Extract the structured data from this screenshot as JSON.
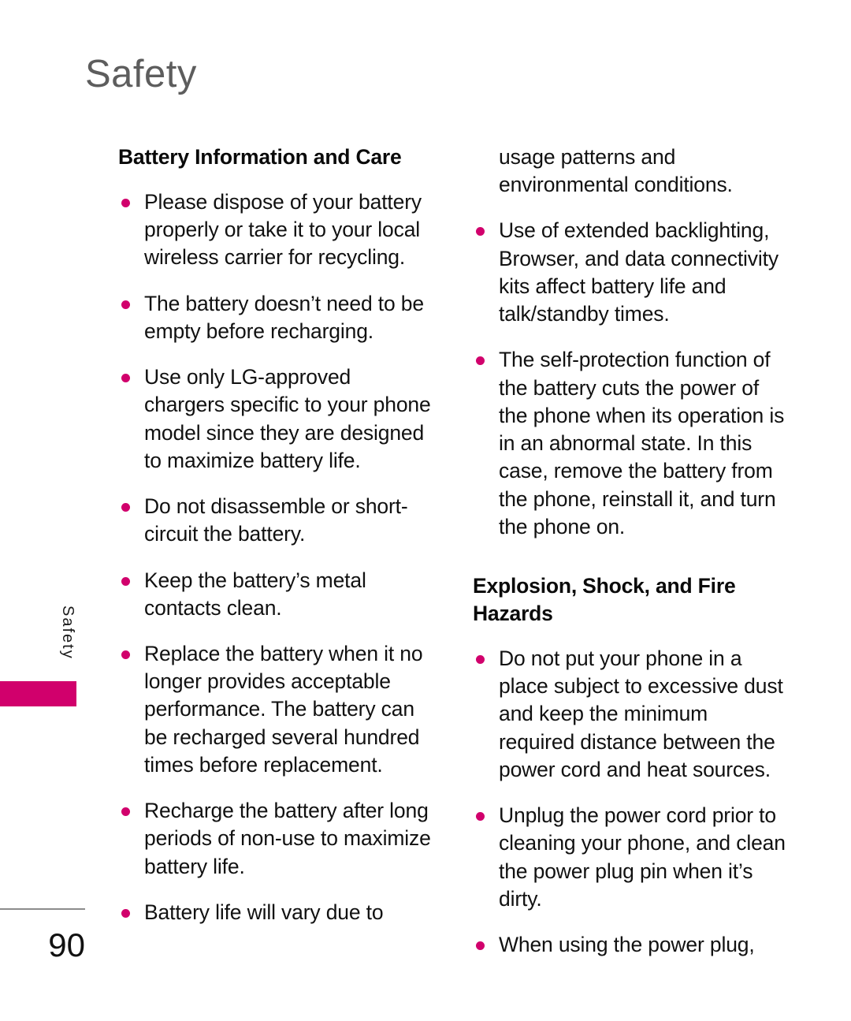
{
  "page": {
    "header_title": "Safety",
    "side_tab_label": "Safety",
    "folio_number": "90",
    "accent_color": "#d1006c",
    "header_color": "#5d5d5d",
    "body_color": "#111111"
  },
  "left_column": {
    "heading": "Battery Information and Care",
    "bullets": [
      "Please dispose of your battery properly or take it to your local wireless carrier for recycling.",
      "The battery doesn’t need to be empty before recharging.",
      "Use only LG-approved chargers specific to your phone model since they are designed to maximize battery life.",
      "Do not disassemble or short-circuit the battery.",
      "Keep the battery’s metal contacts clean.",
      "Replace the battery when it no longer provides acceptable performance. The battery can be recharged several hundred times before replacement.",
      "Recharge the battery after long periods of non-use to maximize battery life.",
      "Battery life will vary due to"
    ]
  },
  "right_column": {
    "continuation": "usage patterns and environmental conditions.",
    "bullets_top": [
      "Use of extended backlighting, Browser, and data connectivity kits affect battery life and talk/standby times.",
      "The self-protection function of the battery cuts the power of the phone when its operation is in an abnormal state. In this case, remove the battery from the phone, reinstall it, and turn the phone on."
    ],
    "heading": "Explosion, Shock, and Fire Hazards",
    "bullets_bottom": [
      "Do not put your phone in a place subject to excessive dust and keep the minimum required distance between the power cord and heat sources.",
      "Unplug the power cord prior to cleaning your phone, and clean the power plug pin when it’s dirty.",
      "When using the power plug,"
    ]
  }
}
